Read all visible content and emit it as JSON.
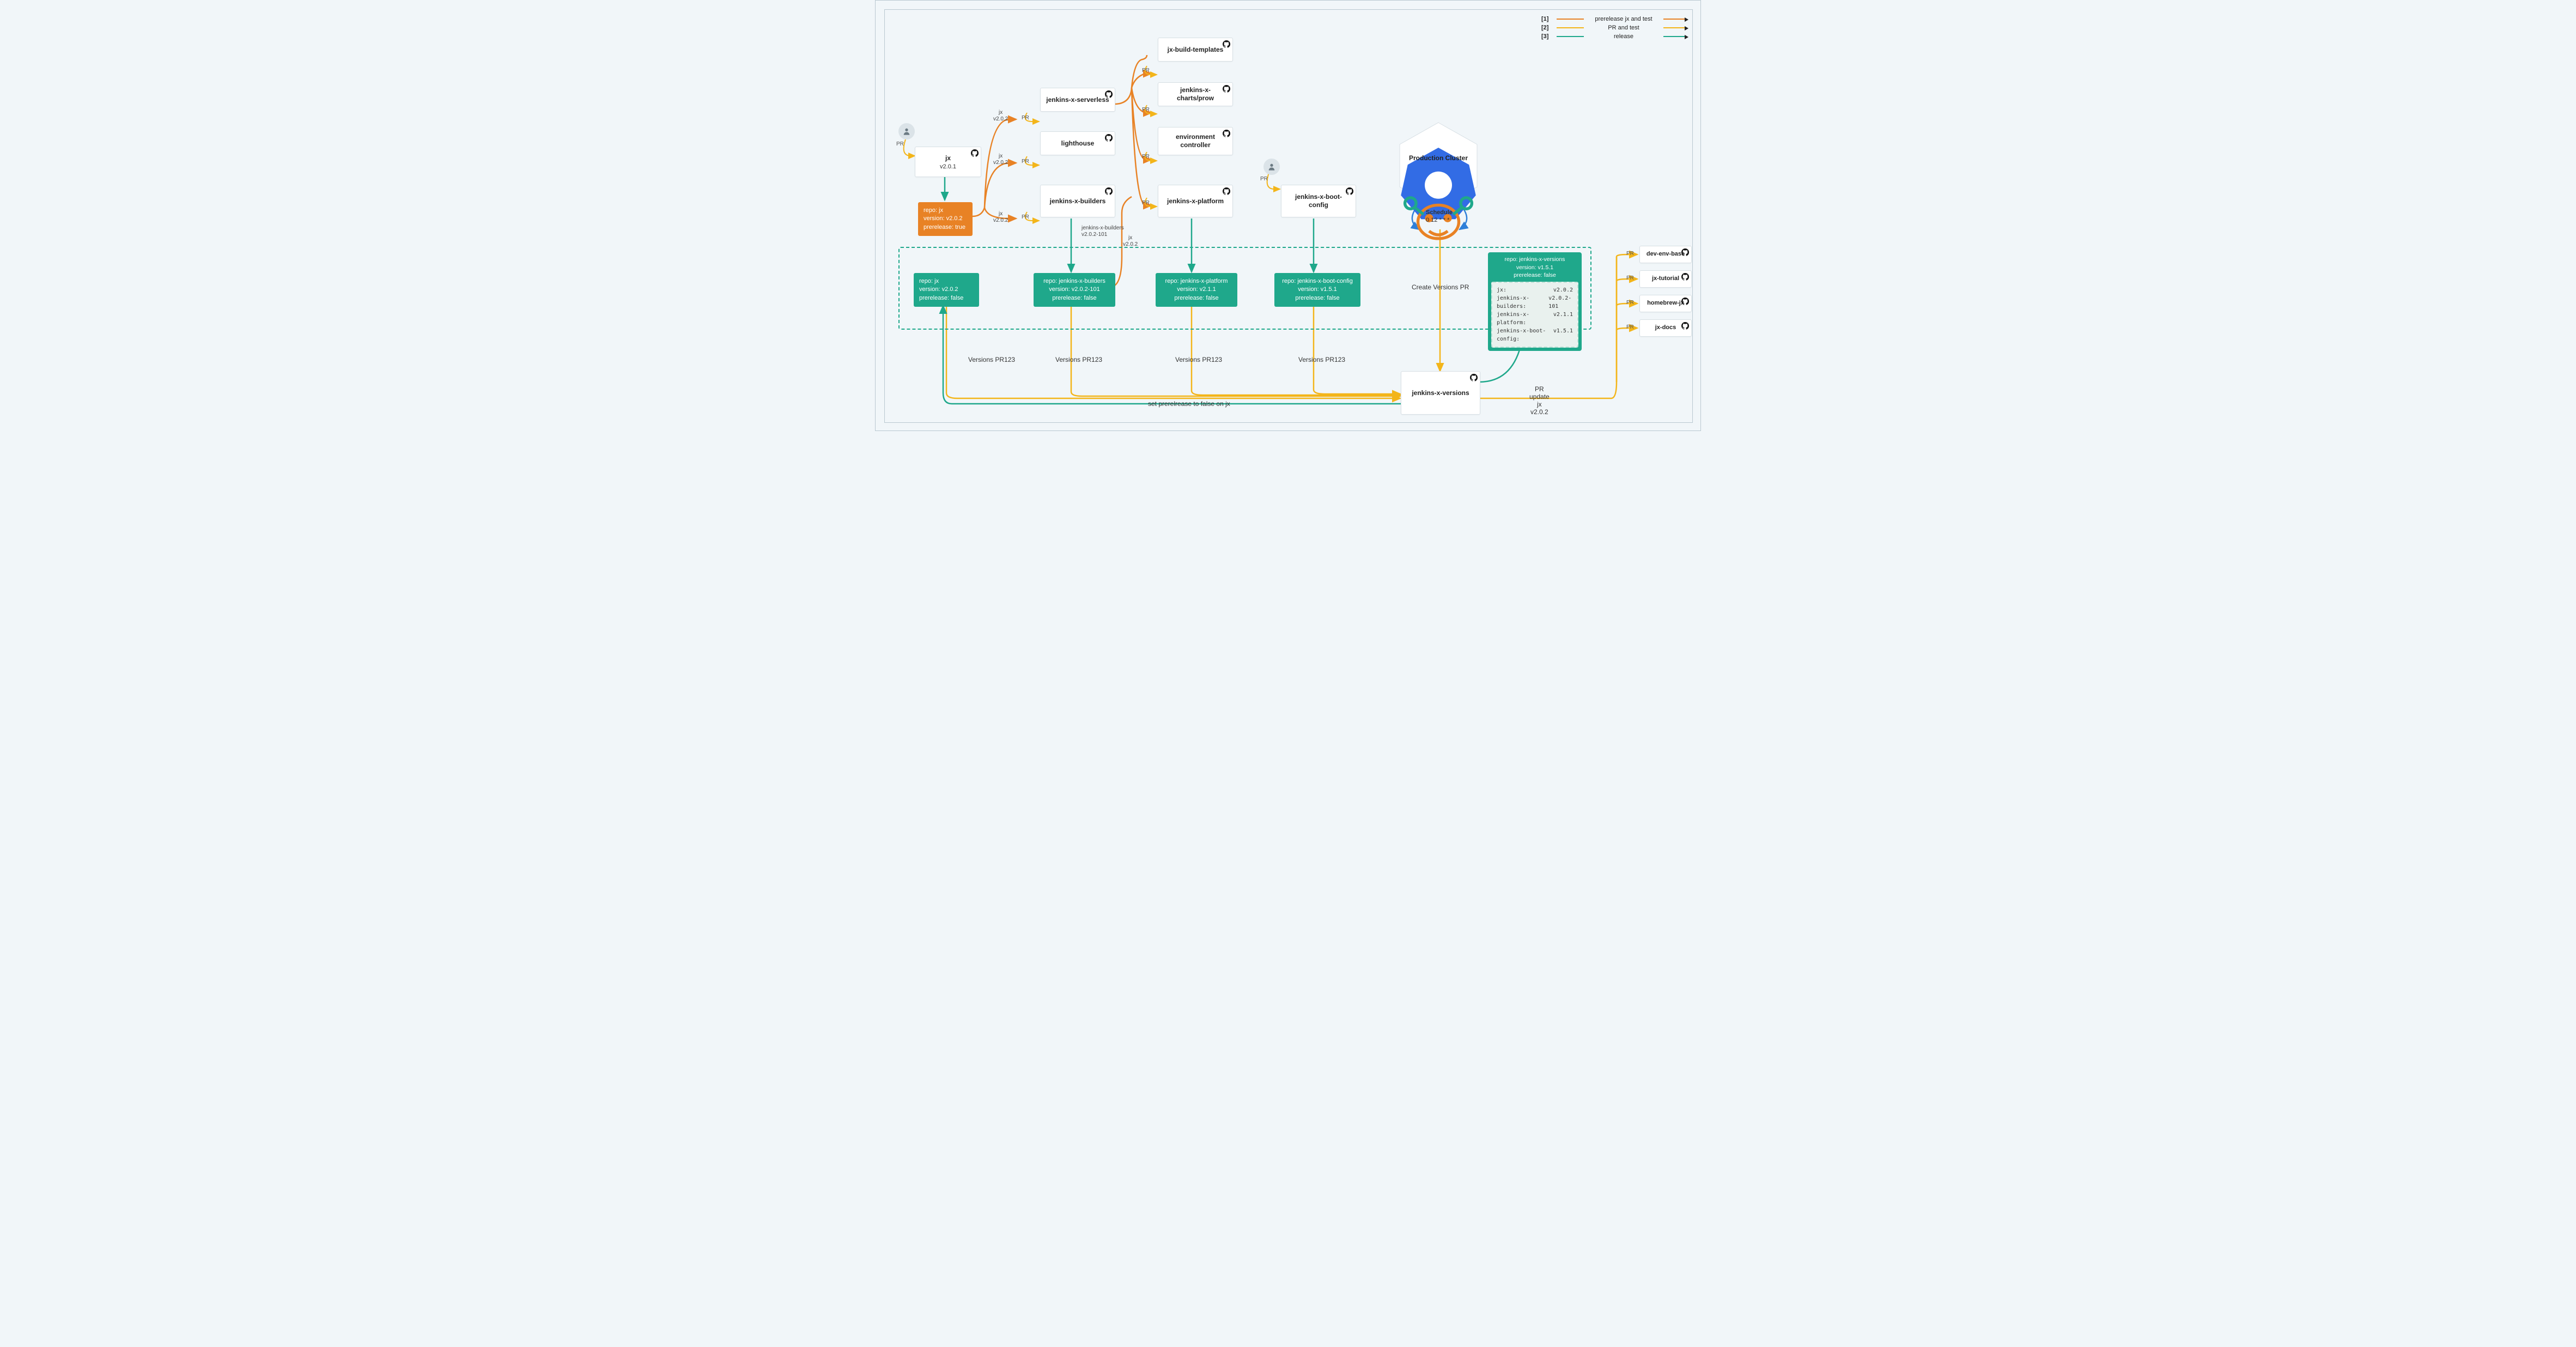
{
  "legend": {
    "items": [
      {
        "idx": "[1]",
        "label": "prerelease jx and test",
        "color": "#e88225"
      },
      {
        "idx": "[2]",
        "label": "PR and test",
        "color": "#f3b51a"
      },
      {
        "idx": "[3]",
        "label": "release",
        "color": "#1fa88b"
      }
    ]
  },
  "boxes": {
    "jx": {
      "title": "jx",
      "subtitle": "v2.0.1"
    },
    "serverless": {
      "title": "jenkins-x-serverless"
    },
    "lighthouse": {
      "title": "lighthouse"
    },
    "builders": {
      "title": "jenkins-x-builders"
    },
    "buildtemplates": {
      "title": "jx-build-templates"
    },
    "prow": {
      "title": "jenkins-x-charts/prow"
    },
    "envcontroller_l1": "environment",
    "envcontroller_l2": "controller",
    "platform": {
      "title": "jenkins-x-platform"
    },
    "bootconfig": {
      "title": "jenkins-x-boot-config"
    },
    "versions": {
      "title": "jenkins-x-versions"
    },
    "devenvbase": "dev-env-base",
    "jxtutorial": "jx-tutorial",
    "homebrew": "homebrew-jx",
    "jxdocs": "jx-docs"
  },
  "teal_boxes": {
    "jx": {
      "repo": "repo: jx",
      "version": "version: v2.0.2",
      "pre": "prerelease: false"
    },
    "builders": {
      "repo": "repo: jenkins-x-builders",
      "version": "version: v2.0.2-101",
      "pre": "prerelease: false"
    },
    "platform": {
      "repo": "repo: jenkins-x-platform",
      "version": "version: v2.1.1",
      "pre": "prerelease: false"
    },
    "bootconfig": {
      "repo": "repo: jenkins-x-boot-config",
      "version": "version: v1.5.1",
      "pre": "prerelease: false"
    }
  },
  "orange_box": {
    "repo": "repo: jx",
    "version": "version: v2.0.2",
    "pre": "prerelease: true"
  },
  "small_labels": {
    "jx1": "jx\nv2.0.2",
    "jx2": "jx\nv2.0.2",
    "jx3": "jx\nv2.0.2",
    "builders_conn": "jenkins-x-builders\nv2.0.2-101",
    "plat_conn": "jx\nv2.0.2"
  },
  "text_labels": {
    "vpr1": "Versions PR123",
    "vpr2": "Versions PR123",
    "vpr3": "Versions PR123",
    "vpr4": "Versions PR123",
    "create_versions_pr": "Create Versions PR",
    "set_prerelease": "set prerelrease to false on jx",
    "pr_update_jx": "PR\nupdate\njx\nv2.0.2",
    "schedule_l1": "Schedule",
    "schedule_l2": "0 12 * * *"
  },
  "cluster": {
    "title": "Production Cluster"
  },
  "versions_card": {
    "header": {
      "repo": "repo: jenkins-x-versions",
      "version": "version: v1.5.1",
      "pre": "prerelease: false"
    },
    "body": [
      {
        "k": "jx:",
        "v": "v2.0.2"
      },
      {
        "k": "jenkins-x-builders:",
        "v": "v2.0.2-101"
      },
      {
        "k": "jenkins-x-platform:",
        "v": "v2.1.1"
      },
      {
        "k": "jenkins-x-boot-config:",
        "v": "v1.5.1"
      }
    ]
  },
  "colors": {
    "orange": "#e88225",
    "yellow": "#f3b51a",
    "teal": "#1fa88b",
    "blue": "#2f7fd8"
  },
  "pr": "PR"
}
